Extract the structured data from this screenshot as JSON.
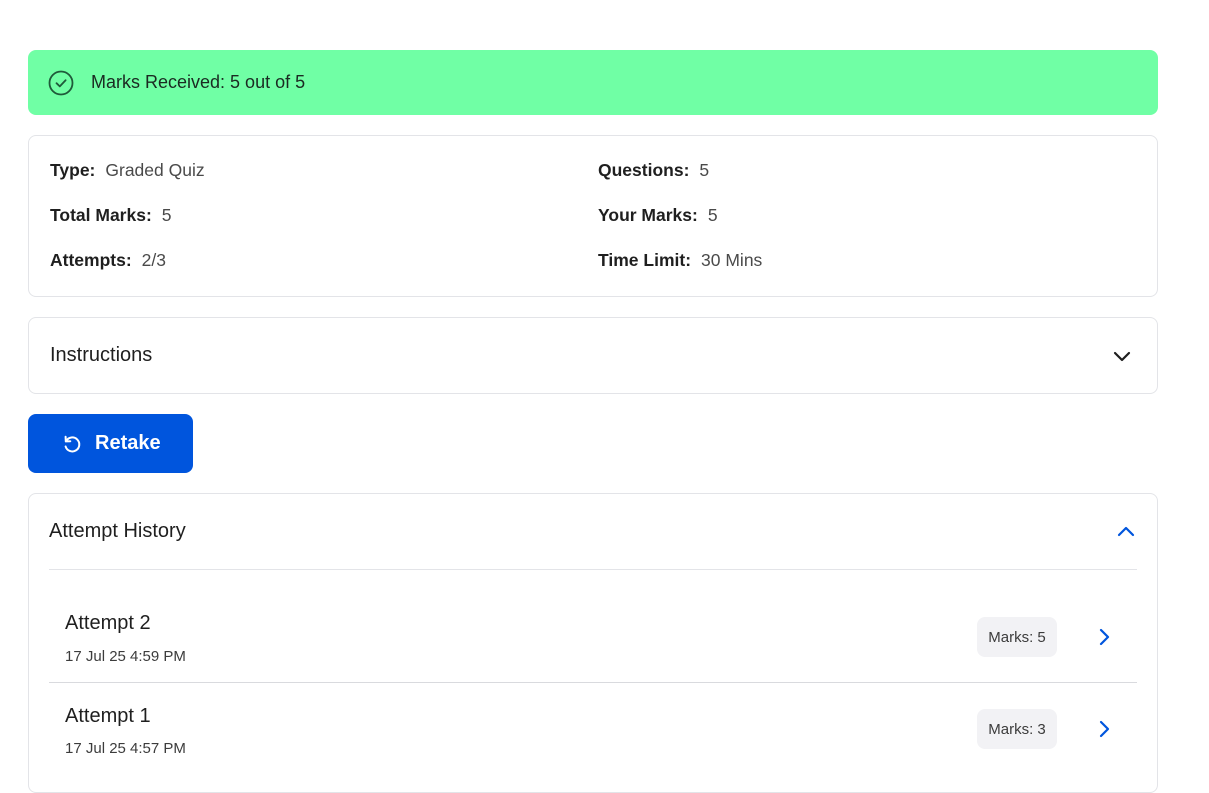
{
  "banner": {
    "text": "Marks Received: 5 out of 5",
    "icon": "check-circle-icon",
    "color": "#70ffa5"
  },
  "info": {
    "type_label": "Type:",
    "type_value": "Graded Quiz",
    "questions_label": "Questions:",
    "questions_value": "5",
    "total_label": "Total Marks:",
    "total_value": "5",
    "your_label": "Your Marks:",
    "your_value": "5",
    "attempts_label": "Attempts:",
    "attempts_value": "2/3",
    "time_label": "Time Limit:",
    "time_value": "30 Mins"
  },
  "instructions": {
    "title": "Instructions",
    "icon": "chevron-down-icon"
  },
  "retake": {
    "label": "Retake",
    "icon": "retake-icon",
    "color": "#0055dd"
  },
  "history": {
    "title": "Attempt History",
    "icon": "chevron-up-icon",
    "attempts": [
      {
        "name": "Attempt 2",
        "date": "17 Jul 25 4:59 PM",
        "marks": "Marks: 5"
      },
      {
        "name": "Attempt 1",
        "date": "17 Jul 25 4:57 PM",
        "marks": "Marks: 3"
      }
    ]
  }
}
